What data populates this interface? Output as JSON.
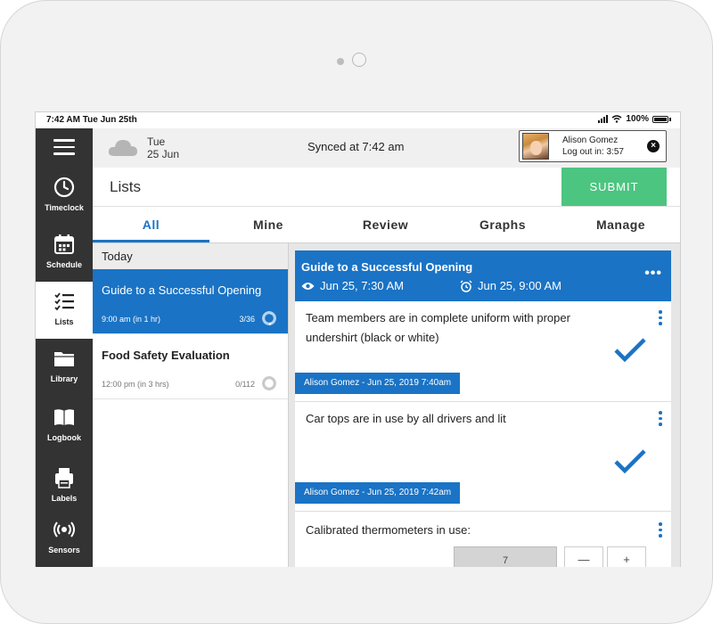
{
  "status_bar": {
    "time": "7:42 AM Tue Jun 25th",
    "battery": "100%"
  },
  "sidebar": {
    "items": [
      {
        "label": "Timeclock",
        "icon": "clock-icon"
      },
      {
        "label": "Schedule",
        "icon": "calendar-icon"
      },
      {
        "label": "Lists",
        "icon": "checklist-icon",
        "active": true
      },
      {
        "label": "Library",
        "icon": "folder-icon"
      },
      {
        "label": "Logbook",
        "icon": "book-icon"
      },
      {
        "label": "Labels",
        "icon": "printer-icon"
      },
      {
        "label": "Sensors",
        "icon": "sensor-icon"
      }
    ]
  },
  "header": {
    "weather_icon": "cloud-icon",
    "day": "Tue",
    "date": "25 Jun",
    "sync_status": "Synced at 7:42 am",
    "user": {
      "name": "Alison Gomez",
      "logout": "Log out in: 3:57",
      "close": "×"
    }
  },
  "page": {
    "title": "Lists",
    "submit_label": "SUBMIT"
  },
  "tabs": [
    {
      "label": "All",
      "active": true
    },
    {
      "label": "Mine"
    },
    {
      "label": "Review"
    },
    {
      "label": "Graphs"
    },
    {
      "label": "Manage"
    }
  ],
  "list_section": {
    "header": "Today",
    "items": [
      {
        "title": "Guide to a Successful Opening",
        "time": "9:00 am (in 1 hr)",
        "count": "3/36",
        "progress": 0.083,
        "active": true
      },
      {
        "title": "Food Safety Evaluation",
        "time": "12:00 pm (in 3 hrs)",
        "count": "0/112",
        "progress": 0.0
      }
    ]
  },
  "detail": {
    "title": "Guide to a Successful Opening",
    "start": "Jun 25, 7:30 AM",
    "due": "Jun 25, 9:00 AM",
    "more": "•••",
    "tasks": [
      {
        "text": "Team members are in complete uniform with proper undershirt (black or white)",
        "signature": "Alison Gomez - Jun 25, 2019 7:40am",
        "completed": true
      },
      {
        "text": "Car tops are in use by all drivers and lit",
        "signature": "Alison Gomez - Jun 25, 2019 7:42am",
        "completed": true
      },
      {
        "text": "Calibrated thermometers in use:",
        "value": "7",
        "minus": "—",
        "plus": "+"
      }
    ]
  },
  "colors": {
    "accent": "#1a73c5",
    "submit": "#4cc580",
    "sidebar": "#333333"
  }
}
